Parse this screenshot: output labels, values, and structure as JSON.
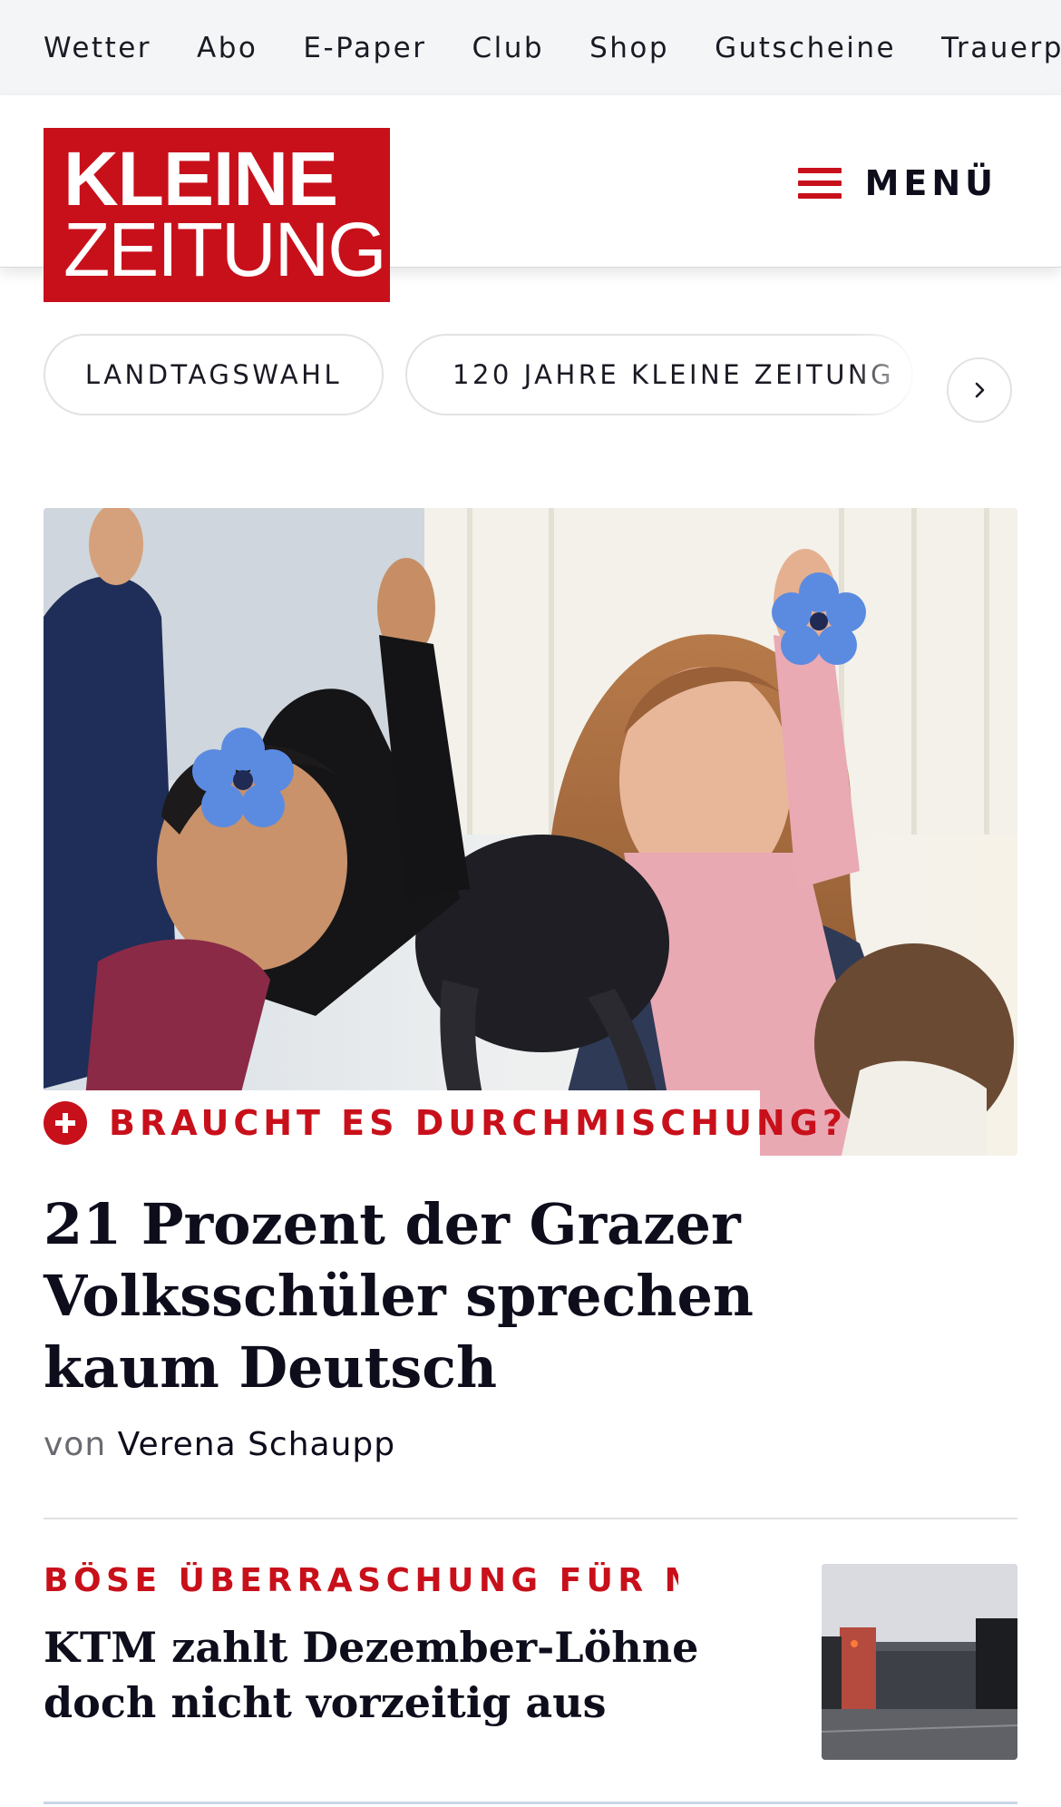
{
  "topnav": {
    "items": [
      "Wetter",
      "Abo",
      "E-Paper",
      "Club",
      "Shop",
      "Gutscheine",
      "Trauerportal"
    ]
  },
  "header": {
    "logo_line1": "KLEINE",
    "logo_line2": "ZEITUNG",
    "menu_label": "MENÜ"
  },
  "tags": {
    "items": [
      "LANDTAGSWAHL",
      "120 JAHRE KLEINE ZEITUNG"
    ],
    "next_icon": "chevron-right-icon"
  },
  "hero": {
    "kicker": "BRAUCHT ES DURCHMISCHUNG?",
    "headline": "21 Prozent der Grazer Volksschüler sprechen kaum Deutsch",
    "byline_prefix": "von",
    "author": "Verena Schaupp"
  },
  "teaser": {
    "kicker": "BÖSE ÜBERRASCHUNG FÜR MI…",
    "headline": "KTM zahlt Dezember-Löhne doch nicht vorzeitig aus"
  },
  "colors": {
    "brand_red": "#c8101b",
    "text_dark": "#0d0d1c",
    "topbar_bg": "#f4f5f7"
  }
}
